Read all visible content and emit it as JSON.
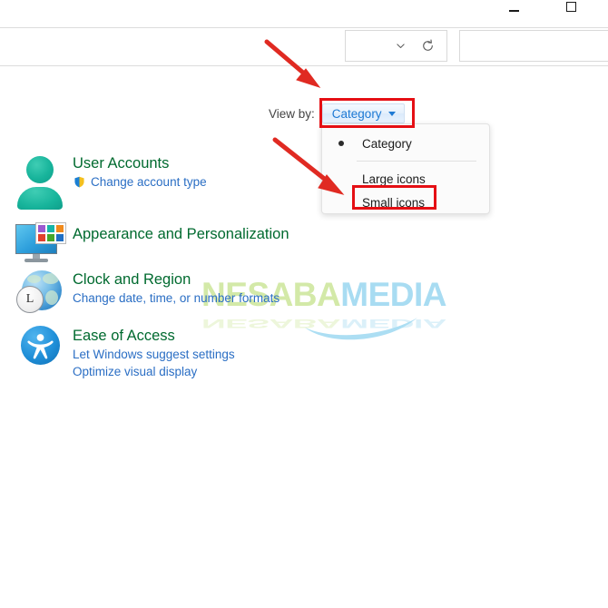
{
  "window": {
    "minimize_label": "Minimize",
    "maximize_label": "Maximize"
  },
  "toolbar": {
    "address_dropdown_icon": "chevron-down-icon",
    "refresh_icon": "refresh-icon",
    "search_placeholder": ""
  },
  "view_by": {
    "label": "View by:",
    "value": "Category",
    "caret_icon": "chevron-down-icon",
    "highlight_color": "#e50f14",
    "accent_color": "#1e7ad4",
    "menu": {
      "items": [
        {
          "label": "Category",
          "selected": true
        },
        {
          "label": "Large icons",
          "selected": false
        },
        {
          "label": "Small icons",
          "selected": false
        }
      ]
    }
  },
  "categories": [
    {
      "title": "User Accounts",
      "icon": "user-accounts-icon",
      "links": [
        {
          "text": "Change account type",
          "icon": "uac-shield-icon"
        }
      ]
    },
    {
      "title": "Appearance and Personalization",
      "icon": "appearance-personalization-icon",
      "links": []
    },
    {
      "title": "Clock and Region",
      "icon": "clock-region-icon",
      "links": [
        {
          "text": "Change date, time, or number formats",
          "icon": ""
        }
      ]
    },
    {
      "title": "Ease of Access",
      "icon": "ease-of-access-icon",
      "links": [
        {
          "text": "Let Windows suggest settings",
          "icon": ""
        },
        {
          "text": "Optimize visual display",
          "icon": ""
        }
      ]
    }
  ],
  "watermark": {
    "part1": "NESABA",
    "part2": "MEDIA",
    "part1_color": "#d3e9a8",
    "part2_color": "#a8dcf2"
  },
  "annotations": {
    "arrow_color": "#e02a22",
    "arrow_count": 2
  },
  "theme": {
    "heading_color": "#006a2f",
    "link_color": "#2a6ec4",
    "background": "#ffffff"
  }
}
